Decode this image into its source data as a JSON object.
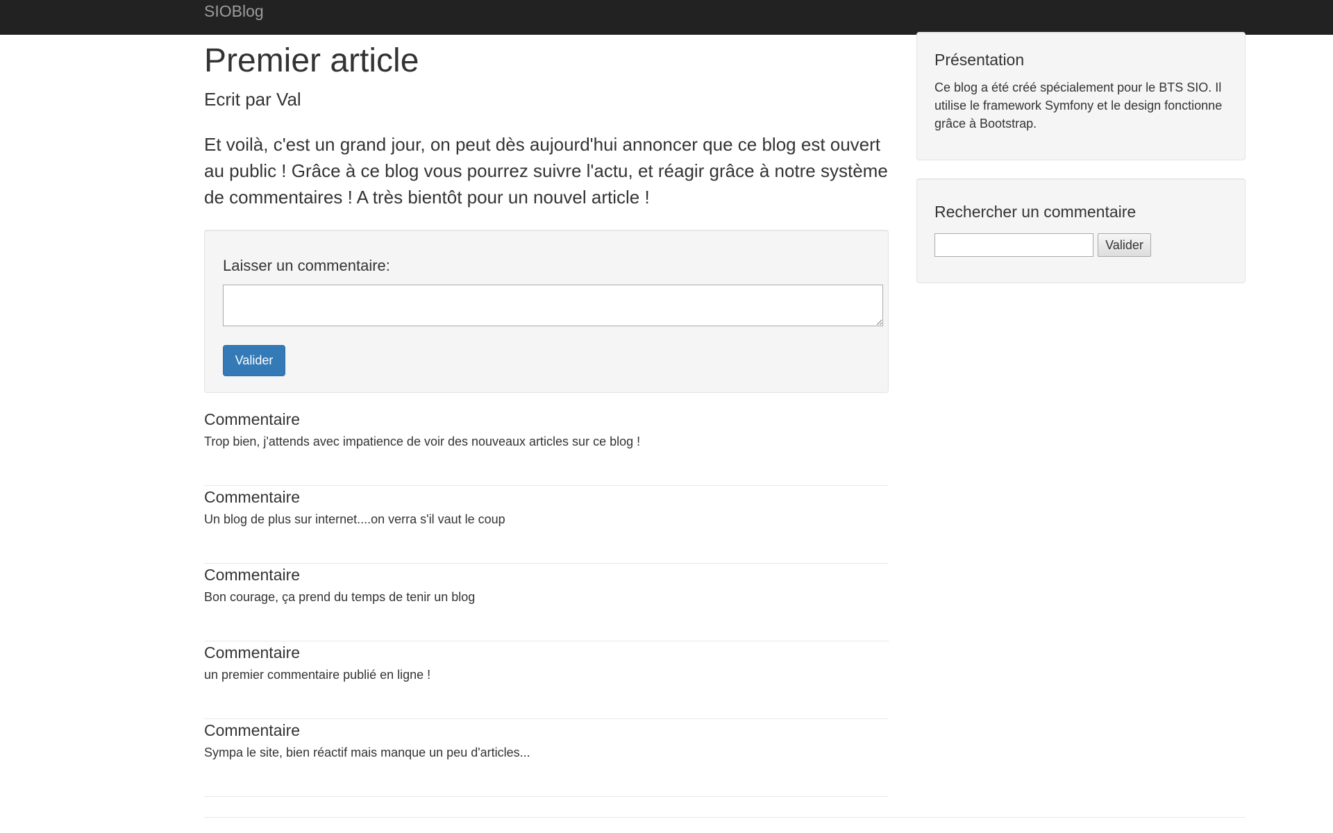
{
  "navbar": {
    "brand": "SIOBlog"
  },
  "article": {
    "title": "Premier article",
    "author": "Ecrit par Val",
    "body": "Et voilà, c'est un grand jour, on peut dès aujourd'hui annoncer que ce blog est ouvert au public ! Grâce à ce blog vous pourrez suivre l'actu, et réagir grâce à notre système de commentaires ! A très bientôt pour un nouvel article !"
  },
  "comment_form": {
    "label": "Laisser un commentaire:",
    "textarea_value": "",
    "submit_label": "Valider"
  },
  "comments": [
    {
      "heading": "Commentaire",
      "text": "Trop bien, j'attends avec impatience de voir des nouveaux articles sur ce blog !"
    },
    {
      "heading": "Commentaire",
      "text": "Un blog de plus sur internet....on verra s'il vaut le coup"
    },
    {
      "heading": "Commentaire",
      "text": "Bon courage, ça prend du temps de tenir un blog"
    },
    {
      "heading": "Commentaire",
      "text": "un premier commentaire publié en ligne !"
    },
    {
      "heading": "Commentaire",
      "text": "Sympa le site, bien réactif mais manque un peu d'articles..."
    }
  ],
  "sidebar": {
    "presentation": {
      "title": "Présentation",
      "text": "Ce blog a été créé spécialement pour le BTS SIO. Il utilise le framework Symfony et le design fonctionne grâce à Bootstrap."
    },
    "search": {
      "title": "Rechercher un commentaire",
      "input_value": "",
      "button_label": "Valider"
    }
  },
  "colors": {
    "navbar_bg": "#222222",
    "brand": "#9d9d9d",
    "primary": "#337ab7",
    "well_bg": "#f5f5f5",
    "text": "#333333"
  }
}
